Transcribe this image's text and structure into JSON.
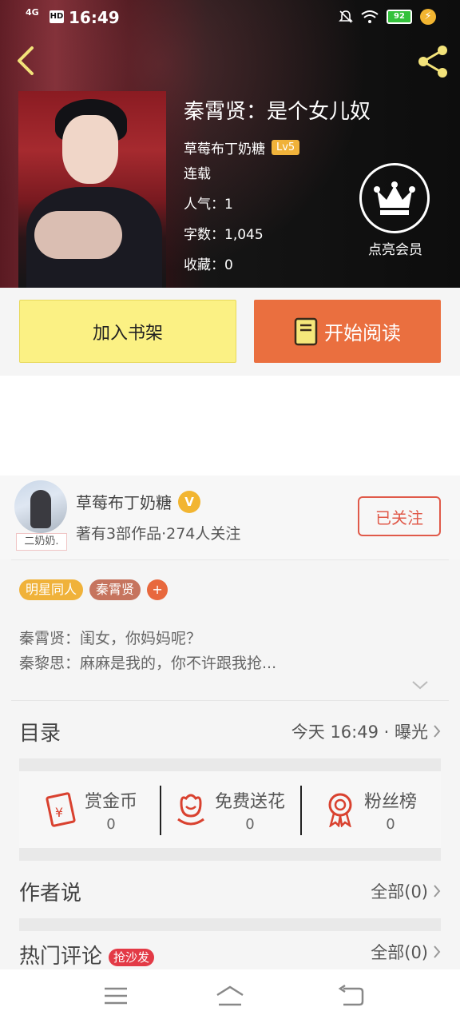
{
  "status": {
    "network": "4G",
    "hd": "HD",
    "time": "16:49",
    "battery": "92"
  },
  "book": {
    "title": "秦霄贤：是个女儿奴",
    "author": "草莓布丁奶糖",
    "level": "Lv5",
    "status": "连载",
    "popularity": "人气：1",
    "word_count": "字数：1,045",
    "favorites": "收藏：0",
    "vip_label": "点亮会员"
  },
  "actions": {
    "add_shelf": "加入书架",
    "start_read": "开始阅读"
  },
  "author_card": {
    "name": "草莓布丁奶糖",
    "verified": "V",
    "avatar_tag": "二奶奶.",
    "sub": "著有3部作品·274人关注",
    "follow": "已关注"
  },
  "tags": [
    "明星同人",
    "秦霄贤",
    "+"
  ],
  "excerpt": [
    "秦霄贤：闺女，你妈妈呢？",
    "秦黎思：麻麻是我的，你不许跟我抢..."
  ],
  "toc": {
    "title": "目录",
    "update": "今天 16:49 · 曝光"
  },
  "stats": [
    {
      "label": "赏金币",
      "value": "0",
      "icon": "red-envelope-icon"
    },
    {
      "label": "免费送花",
      "value": "0",
      "icon": "flower-icon"
    },
    {
      "label": "粉丝榜",
      "value": "0",
      "icon": "medal-icon"
    }
  ],
  "author_says": {
    "title": "作者说",
    "link": "全部(0)"
  },
  "comments": {
    "title": "热门评论",
    "badge": "抢沙发",
    "link": "全部(0)"
  },
  "colors": {
    "accent_orange": "#ea6f3f",
    "shelf_yellow": "#fbf184",
    "follow_red": "#e05a4a",
    "tag_gold": "#f0b23a"
  }
}
